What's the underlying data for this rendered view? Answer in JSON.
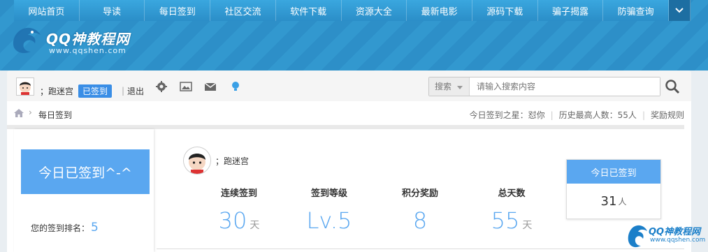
{
  "nav": {
    "items": [
      "网站首页",
      "导读",
      "每日签到",
      "社区交流",
      "软件下载",
      "资源大全",
      "最新电影",
      "源码下载",
      "骗子揭露",
      "防骗查询"
    ]
  },
  "logo": {
    "title": "QQ神教程网",
    "subtitle": "www.qqshen.com"
  },
  "userbar": {
    "username": "；跑迷宫",
    "signed_badge": "已签到",
    "logout": "退出",
    "search_type": "搜索",
    "search_placeholder": "请输入搜索内容"
  },
  "breadcrumb": {
    "current": "每日签到",
    "star_label": "今日签到之星：怼你",
    "max_label": "历史最高人数：55人",
    "rules_label": "奖励规则"
  },
  "left": {
    "button": "今日已签到^-^",
    "rank_label": "您的签到排名：",
    "rank_value": "5"
  },
  "center": {
    "username": "；跑迷宫",
    "stats": [
      {
        "label": "连续签到",
        "value": "30",
        "unit": "天"
      },
      {
        "label": "签到等级",
        "value": "Lv.5",
        "unit": ""
      },
      {
        "label": "积分奖励",
        "value": "8",
        "unit": ""
      },
      {
        "label": "总天数",
        "value": "55",
        "unit": "天"
      }
    ]
  },
  "rightcard": {
    "title": "今日已签到",
    "count": "31",
    "unit": "人"
  },
  "watermark": {
    "title": "QQ神教程网",
    "subtitle": "www.qqshen.com"
  },
  "colors": {
    "accent": "#5aa7f0",
    "banner": "#2f90c9"
  }
}
